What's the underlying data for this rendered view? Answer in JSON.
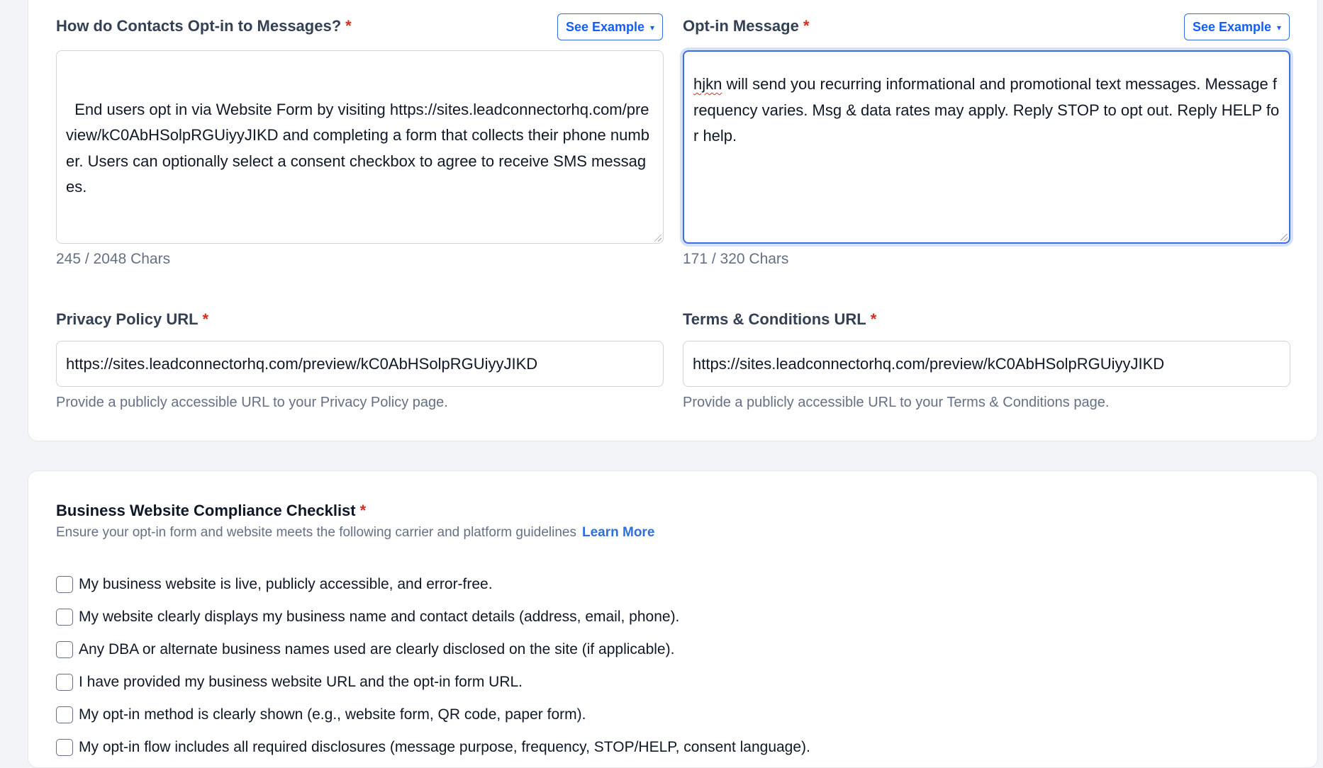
{
  "optin_method": {
    "label": "How do Contacts Opt-in to Messages?",
    "required_mark": "*",
    "see_example": "See Example",
    "value": "End users opt in via Website Form by visiting https://sites.leadconnectorhq.com/preview/kC0AbHSolpRGUiyyJIKD and completing a form that collects their phone number. Users can optionally select a consent checkbox to agree to receive SMS messages.",
    "counter": "245 / 2048 Chars"
  },
  "optin_message": {
    "label": "Opt-in Message",
    "required_mark": "*",
    "see_example": "See Example",
    "value_misspelled_word": "hjkn",
    "value_rest": " will send you recurring informational and promotional text messages. Message frequency varies. Msg & data rates may apply. Reply STOP to opt out. Reply HELP for help.",
    "counter": "171 / 320 Chars"
  },
  "privacy_policy": {
    "label": "Privacy Policy URL",
    "required_mark": "*",
    "value": "https://sites.leadconnectorhq.com/preview/kC0AbHSolpRGUiyyJIKD",
    "hint": "Provide a publicly accessible URL to your Privacy Policy page."
  },
  "terms": {
    "label": "Terms & Conditions URL",
    "required_mark": "*",
    "value": "https://sites.leadconnectorhq.com/preview/kC0AbHSolpRGUiyyJIKD",
    "hint": "Provide a publicly accessible URL to your Terms & Conditions page."
  },
  "checklist": {
    "title": "Business Website Compliance Checklist",
    "required_mark": "*",
    "subtitle": "Ensure your opt-in form and website meets the following carrier and platform guidelines",
    "learn_more": "Learn More",
    "items": [
      "My business website is live, publicly accessible, and error-free.",
      "My website clearly displays my business name and contact details (address, email, phone).",
      "Any DBA or alternate business names used are clearly disclosed on the site (if applicable).",
      "I have provided my business website URL and the opt-in form URL.",
      "My opt-in method is clearly shown (e.g., website form, QR code, paper form).",
      "My opt-in flow includes all required disclosures (message purpose, frequency, STOP/HELP, consent language)."
    ]
  },
  "icons": {
    "dropdown": "chevron-down-icon",
    "resize": "resize-grip-icon"
  },
  "colors": {
    "accent": "#155eef",
    "required": "#d92d20",
    "focus": "#3b6fe0"
  }
}
